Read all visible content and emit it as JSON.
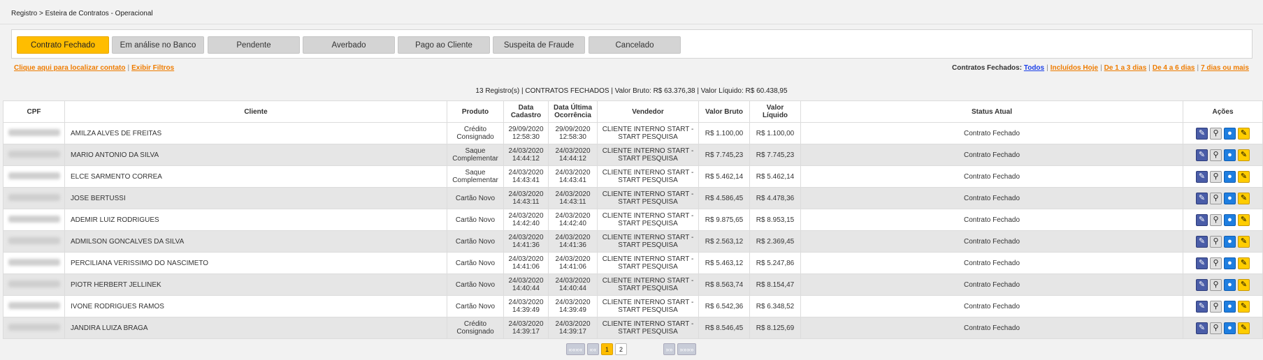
{
  "breadcrumb": "Registro > Esteira de Contratos - Operacional",
  "tabs": [
    {
      "label": "Contrato Fechado",
      "active": true
    },
    {
      "label": "Em análise no Banco",
      "active": false
    },
    {
      "label": "Pendente",
      "active": false
    },
    {
      "label": "Averbado",
      "active": false
    },
    {
      "label": "Pago ao Cliente",
      "active": false
    },
    {
      "label": "Suspeita de Fraude",
      "active": false
    },
    {
      "label": "Cancelado",
      "active": false
    }
  ],
  "links_left": {
    "locate": "Clique aqui para localizar contato",
    "filters": "Exibir Filtros"
  },
  "links_right": {
    "label": "Contratos Fechados:",
    "all": "Todos",
    "today": "Incluídos Hoje",
    "d1_3": "De 1 a 3 dias",
    "d4_6": "De 4 a 6 dias",
    "d7": "7 dias ou mais"
  },
  "summary": "13 Registro(s) | CONTRATOS FECHADOS | Valor Bruto: R$ 63.376,38 | Valor Líquido: R$ 60.438,95",
  "table": {
    "headers": {
      "cpf": "CPF",
      "cliente": "Cliente",
      "produto": "Produto",
      "data_cadastro_1": "Data",
      "data_cadastro_2": "Cadastro",
      "data_ultima_1": "Data Última",
      "data_ultima_2": "Ocorrência",
      "vendedor": "Vendedor",
      "valor_bruto": "Valor Bruto",
      "valor_liquido_1": "Valor",
      "valor_liquido_2": "Líquido",
      "status": "Status Atual",
      "acoes": "Ações"
    },
    "rows": [
      {
        "cliente": "AMILZA ALVES DE FREITAS",
        "produto": [
          "Crédito",
          "Consignado"
        ],
        "cad": [
          "29/09/2020",
          "12:58:30"
        ],
        "ult": [
          "29/09/2020",
          "12:58:30"
        ],
        "vendedor": [
          "CLIENTE INTERNO START -",
          "START PESQUISA"
        ],
        "bruto": "R$ 1.100,00",
        "liquido": "R$ 1.100,00",
        "status": "Contrato Fechado"
      },
      {
        "cliente": "MARIO ANTONIO DA SILVA",
        "produto": [
          "Saque",
          "Complementar"
        ],
        "cad": [
          "24/03/2020",
          "14:44:12"
        ],
        "ult": [
          "24/03/2020",
          "14:44:12"
        ],
        "vendedor": [
          "CLIENTE INTERNO START -",
          "START PESQUISA"
        ],
        "bruto": "R$ 7.745,23",
        "liquido": "R$ 7.745,23",
        "status": "Contrato Fechado"
      },
      {
        "cliente": "ELCE SARMENTO CORREA",
        "produto": [
          "Saque",
          "Complementar"
        ],
        "cad": [
          "24/03/2020",
          "14:43:41"
        ],
        "ult": [
          "24/03/2020",
          "14:43:41"
        ],
        "vendedor": [
          "CLIENTE INTERNO START -",
          "START PESQUISA"
        ],
        "bruto": "R$ 5.462,14",
        "liquido": "R$ 5.462,14",
        "status": "Contrato Fechado"
      },
      {
        "cliente": "JOSE BERTUSSI",
        "produto": [
          "Cartão Novo"
        ],
        "cad": [
          "24/03/2020",
          "14:43:11"
        ],
        "ult": [
          "24/03/2020",
          "14:43:11"
        ],
        "vendedor": [
          "CLIENTE INTERNO START -",
          "START PESQUISA"
        ],
        "bruto": "R$ 4.586,45",
        "liquido": "R$ 4.478,36",
        "status": "Contrato Fechado"
      },
      {
        "cliente": "ADEMIR LUIZ RODRIGUES",
        "produto": [
          "Cartão Novo"
        ],
        "cad": [
          "24/03/2020",
          "14:42:40"
        ],
        "ult": [
          "24/03/2020",
          "14:42:40"
        ],
        "vendedor": [
          "CLIENTE INTERNO START -",
          "START PESQUISA"
        ],
        "bruto": "R$ 9.875,65",
        "liquido": "R$ 8.953,15",
        "status": "Contrato Fechado"
      },
      {
        "cliente": "ADMILSON GONCALVES DA SILVA",
        "produto": [
          "Cartão Novo"
        ],
        "cad": [
          "24/03/2020",
          "14:41:36"
        ],
        "ult": [
          "24/03/2020",
          "14:41:36"
        ],
        "vendedor": [
          "CLIENTE INTERNO START -",
          "START PESQUISA"
        ],
        "bruto": "R$ 2.563,12",
        "liquido": "R$ 2.369,45",
        "status": "Contrato Fechado"
      },
      {
        "cliente": "PERCILIANA VERISSIMO DO NASCIMETO",
        "produto": [
          "Cartão Novo"
        ],
        "cad": [
          "24/03/2020",
          "14:41:06"
        ],
        "ult": [
          "24/03/2020",
          "14:41:06"
        ],
        "vendedor": [
          "CLIENTE INTERNO START -",
          "START PESQUISA"
        ],
        "bruto": "R$ 5.463,12",
        "liquido": "R$ 5.247,86",
        "status": "Contrato Fechado"
      },
      {
        "cliente": "PIOTR HERBERT JELLINEK",
        "produto": [
          "Cartão Novo"
        ],
        "cad": [
          "24/03/2020",
          "14:40:44"
        ],
        "ult": [
          "24/03/2020",
          "14:40:44"
        ],
        "vendedor": [
          "CLIENTE INTERNO START -",
          "START PESQUISA"
        ],
        "bruto": "R$ 8.563,74",
        "liquido": "R$ 8.154,47",
        "status": "Contrato Fechado"
      },
      {
        "cliente": "IVONE RODRIGUES RAMOS",
        "produto": [
          "Cartão Novo"
        ],
        "cad": [
          "24/03/2020",
          "14:39:49"
        ],
        "ult": [
          "24/03/2020",
          "14:39:49"
        ],
        "vendedor": [
          "CLIENTE INTERNO START -",
          "START PESQUISA"
        ],
        "bruto": "R$ 6.542,36",
        "liquido": "R$ 6.348,52",
        "status": "Contrato Fechado"
      },
      {
        "cliente": "JANDIRA LUIZA BRAGA",
        "produto": [
          "Crédito",
          "Consignado"
        ],
        "cad": [
          "24/03/2020",
          "14:39:17"
        ],
        "ult": [
          "24/03/2020",
          "14:39:17"
        ],
        "vendedor": [
          "CLIENTE INTERNO START -",
          "START PESQUISA"
        ],
        "bruto": "R$ 8.546,45",
        "liquido": "R$ 8.125,69",
        "status": "Contrato Fechado"
      }
    ],
    "row_actions": [
      "edit-icon",
      "search-user-icon",
      "user-icon",
      "note-icon"
    ]
  },
  "pager": {
    "first": "««««",
    "prev": "««",
    "pages": [
      "1",
      "2"
    ],
    "current": "1",
    "next": "»»",
    "last": "»»»»"
  },
  "colors": {
    "accent": "#ffbd00",
    "link": "#ef7c00",
    "link_blue": "#1a3fe8"
  }
}
